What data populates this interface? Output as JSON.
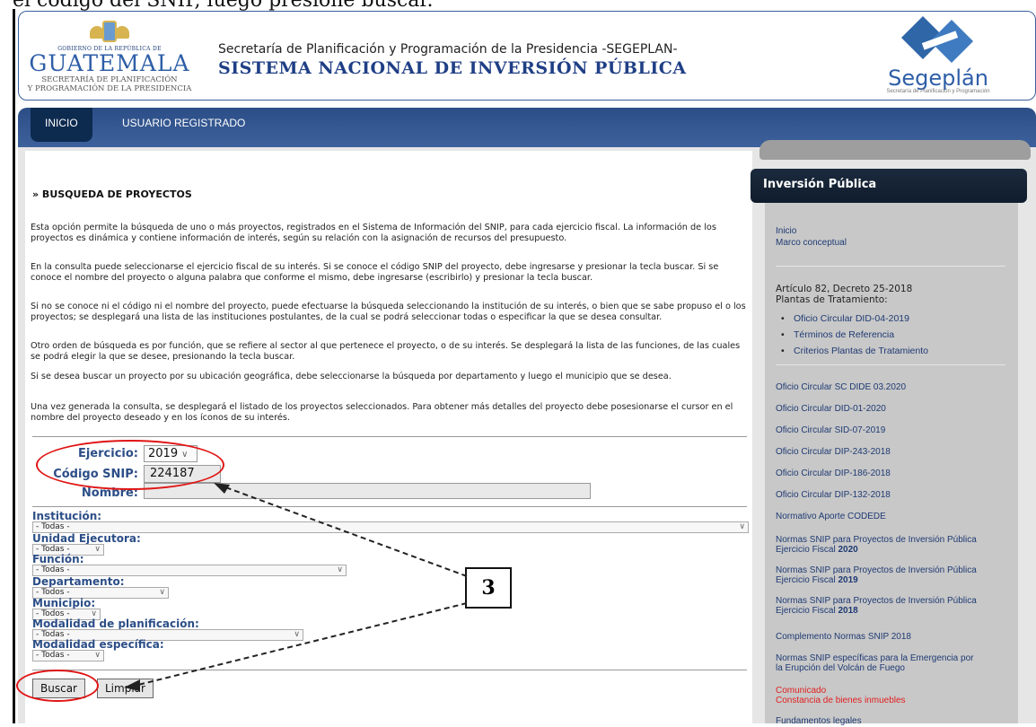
{
  "caption": "el código del SNIP, luego presione buscar.",
  "header": {
    "gt_small": "GOBIERNO DE LA REPÚBLICA DE",
    "gt_name": "GUATEMALA",
    "gt_sub1": "SECRETARÍA DE PLANIFICACIÓN",
    "gt_sub2": "Y PROGRAMACIÓN DE LA PRESIDENCIA",
    "line1": "Secretaría de Planificación y Programación de la Presidencia -SEGEPLAN-",
    "line2": "SISTEMA NACIONAL DE INVERSIÓN PÚBLICA",
    "sg_name": "Segeplán",
    "sg_sub": "Secretaría de Planificación y Programación"
  },
  "nav": {
    "tabs": [
      "INICIO",
      "USUARIO REGISTRADO"
    ]
  },
  "main": {
    "title": "» BUSQUEDA DE PROYECTOS",
    "paragraphs": [
      "Esta opción permite la búsqueda de uno o más proyectos, registrados en el Sistema de Información del SNIP, para cada ejercicio fiscal. La información de los proyectos es dinámica y contiene información de interés, según su relación con la asignación de recursos del presupuesto.",
      "En la consulta puede seleccionarse el ejercicio fiscal de su interés. Si se conoce el código SNIP del proyecto, debe ingresarse y presionar la tecla buscar. Si se conoce el nombre del proyecto o alguna palabra que conforme el mismo, debe ingresarse (escribirlo) y presionar la tecla buscar.",
      "Si no se conoce ni el código ni el nombre del proyecto, puede efectuarse la búsqueda seleccionando la institución de su interés, o bien que se sabe propuso el o los proyectos; se desplegará una lista de las instituciones postulantes, de la cual se podrá seleccionar todas o especificar la que se desea consultar.",
      "Otro orden de búsqueda es por función, que se refiere al sector al que pertenece el proyecto, o de su interés. Se desplegará la lista de las funciones, de las cuales se podrá elegir la que se desee, presionando la tecla buscar.",
      "Si se desea buscar un proyecto por su ubicación geográfica, debe seleccionarse la búsqueda por departamento y luego el municipio que se desea.",
      "Una vez generada la consulta, se desplegará el listado de los proyectos seleccionados. Para obtener más detalles del proyecto debe posesionarse el cursor en el nombre del proyecto deseado y en los íconos de su interés."
    ],
    "form": {
      "ejercicio_label": "Ejercicio:",
      "ejercicio_value": "2019",
      "codigo_label": "Código SNIP:",
      "codigo_value": "224187",
      "nombre_label": "Nombre:",
      "nombre_value": "",
      "institucion_label": "Institución:",
      "institucion_value": "- Todas -",
      "unidad_label": "Unidad Ejecutora:",
      "unidad_value": "- Todas -",
      "funcion_label": "Función:",
      "funcion_value": "- Todas -",
      "departamento_label": "Departamento:",
      "departamento_value": "- Todos -",
      "municipio_label": "Municipio:",
      "municipio_value": "- Todos -",
      "modalidad_plan_label": "Modalidad de planificación:",
      "modalidad_plan_value": "- Todas -",
      "modalidad_esp_label": "Modalidad específica:",
      "modalidad_esp_value": "- Todas -",
      "buscar": "Buscar",
      "limpiar": "Limpiar"
    }
  },
  "sidebar": {
    "title": "Inversión Pública",
    "links_top": [
      "Inicio",
      "Marco conceptual"
    ],
    "heading": [
      "Artículo 82, Decreto 25-2018",
      "Plantas de Tratamiento:"
    ],
    "bullets": [
      "Oficio Circular DID-04-2019",
      "Términos de Referencia",
      "Criterios Plantas de Tratamiento"
    ],
    "links": [
      "Oficio Circular SC DIDE 03.2020",
      "Oficio Circular DID-01-2020",
      "Oficio Circular SID-07-2019",
      "Oficio Circular DIP-243-2018",
      "Oficio Circular DIP-186-2018",
      "Oficio Circular DIP-132-2018",
      "Normativo Aporte CODEDE"
    ],
    "normas": [
      {
        "text": "Normas SNIP para Proyectos de Inversión Pública Ejercicio Fiscal",
        "year": "2020"
      },
      {
        "text": "Normas SNIP para Proyectos de Inversión Pública Ejercicio Fiscal",
        "year": "2019"
      },
      {
        "text": "Normas SNIP para Proyectos de Inversión Pública Ejercicio Fiscal",
        "year": "2018"
      }
    ],
    "complemento": "Complemento Normas SNIP 2018",
    "emergencia": "Normas SNIP específicas para la Emergencia por la Erupción del Volcán de Fuego",
    "comunicado": "Comunicado",
    "constancia": "Constancia de bienes inmuebles",
    "fundamentos": "Fundamentos legales"
  },
  "annotation": {
    "badge": "3"
  },
  "colors": {
    "nav": "#2c4e87",
    "label": "#2c4e87",
    "annotation": "#e01515"
  }
}
